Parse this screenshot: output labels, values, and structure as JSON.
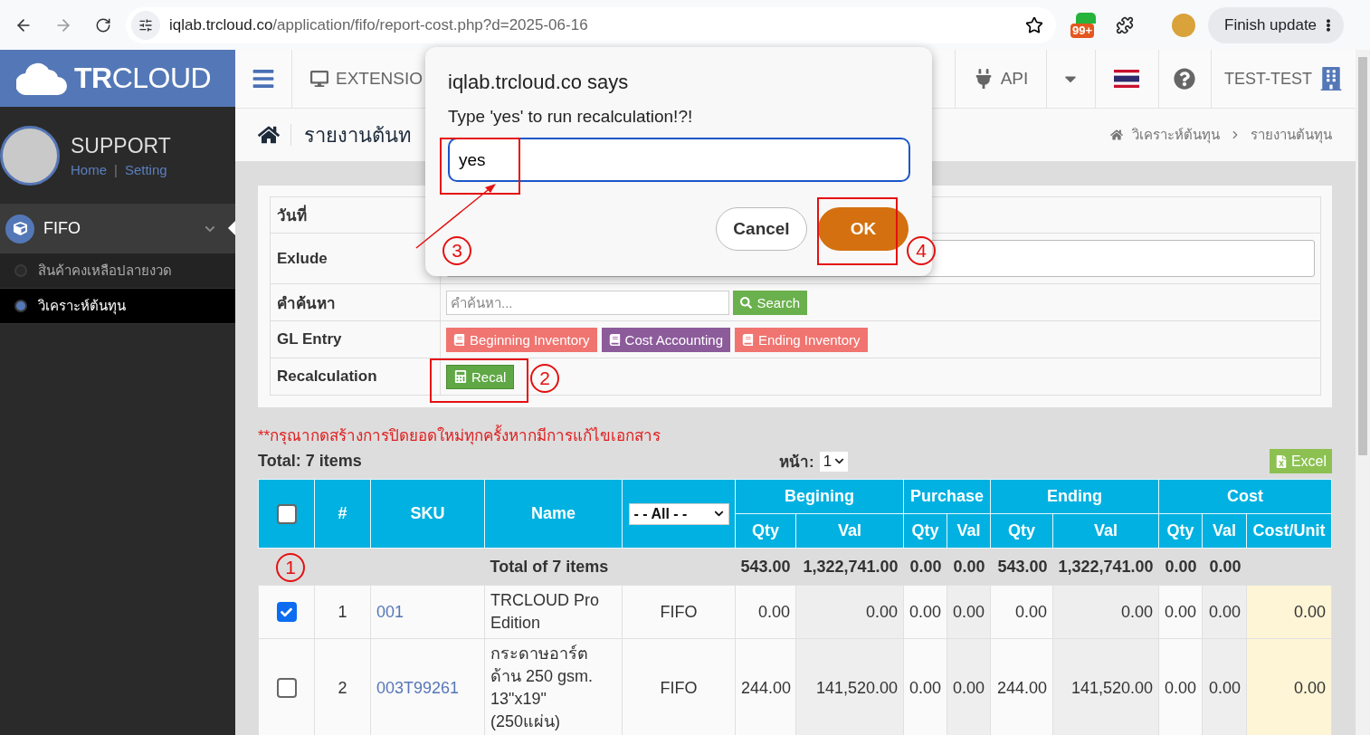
{
  "browser": {
    "url_host": "iqlab.trcloud.co",
    "url_path": "/application/fifo/report-cost.php?d=2025-06-16",
    "badge": "99+",
    "update_button": "Finish update"
  },
  "sidebar": {
    "logo": "**TR**CLOUD",
    "user": "SUPPORT",
    "links": [
      "Home",
      "Setting"
    ],
    "link_separator": "|",
    "menu": {
      "label": "FIFO",
      "expanded": true,
      "children": [
        {
          "label": "สินค้าคงเหลือปลายงวด",
          "selected": false
        },
        {
          "label": "วิเคราะห์ต้นทุน",
          "selected": true
        }
      ]
    }
  },
  "topnav": {
    "extension": "EXTENSIO",
    "api": "API",
    "company": "TEST-TEST"
  },
  "page": {
    "title": "รายงานต้นท",
    "breadcrumb": [
      "วิเคราะห์ต้นทุน",
      "รายงานต้นทุน"
    ]
  },
  "filters": [
    {
      "kind": "empty",
      "label": "วันที่"
    },
    {
      "kind": "input",
      "label": "Exlude"
    },
    {
      "kind": "search",
      "label": "คำค้นหา",
      "placeholder": "คำค้นหา...",
      "button": "Search"
    },
    {
      "kind": "buttons",
      "label": "GL Entry",
      "buttons": [
        {
          "label": "Beginning Inventory",
          "color": "#f07470"
        },
        {
          "label": "Cost Accounting",
          "color": "#8c5b9a"
        },
        {
          "label": "Ending Inventory",
          "color": "#f07470"
        }
      ]
    },
    {
      "kind": "recal",
      "label": "Recalculation",
      "button": "Recal"
    }
  ],
  "note": "**กรุณากดสร้างการปิดยอดใหม่ทุกครั้งหากมีการแก้ไขเอกสาร",
  "total": "Total: 7 items",
  "pager": {
    "label": "หน้า:",
    "value": "1"
  },
  "excel": "Excel",
  "table": {
    "header_checked": false,
    "type_filter": "- - All - -",
    "top": [
      "#",
      "SKU",
      "Name"
    ],
    "groups": [
      "Begining",
      "Purchase",
      "Ending",
      "Cost"
    ],
    "columns": [
      "Qty",
      "Val",
      "Qty",
      "Val",
      "Qty",
      "Val",
      "Qty",
      "Val",
      "Cost/Unit"
    ],
    "total_row": {
      "label": "Total of 7 items",
      "values": [
        "543.00",
        "1,322,741.00",
        "0.00",
        "0.00",
        "543.00",
        "1,322,741.00",
        "0.00",
        "0.00"
      ]
    },
    "rows": [
      {
        "checked": true,
        "no": "1",
        "sku": "001",
        "name": "TRCLOUD Pro Edition",
        "type": "FIFO",
        "values": [
          "0.00",
          "0.00",
          "0.00",
          "0.00",
          "0.00",
          "0.00",
          "0.00",
          "0.00",
          "0.00"
        ]
      },
      {
        "checked": false,
        "no": "2",
        "sku": "003T99261",
        "name": "กระดาษอาร์ตด้าน 250 gsm. 13\"x19\" (250แผ่น)",
        "type": "FIFO",
        "values": [
          "244.00",
          "141,520.00",
          "0.00",
          "0.00",
          "244.00",
          "141,520.00",
          "0.00",
          "0.00",
          "0.00"
        ]
      }
    ]
  },
  "dialog": {
    "title": "iqlab.trcloud.co says",
    "message": "Type 'yes' to run recalculation!?!",
    "value": "yes",
    "cancel": "Cancel",
    "ok": "OK"
  },
  "annotations": [
    {
      "label": "1"
    },
    {
      "label": "2"
    },
    {
      "label": "3"
    },
    {
      "label": "4"
    }
  ]
}
